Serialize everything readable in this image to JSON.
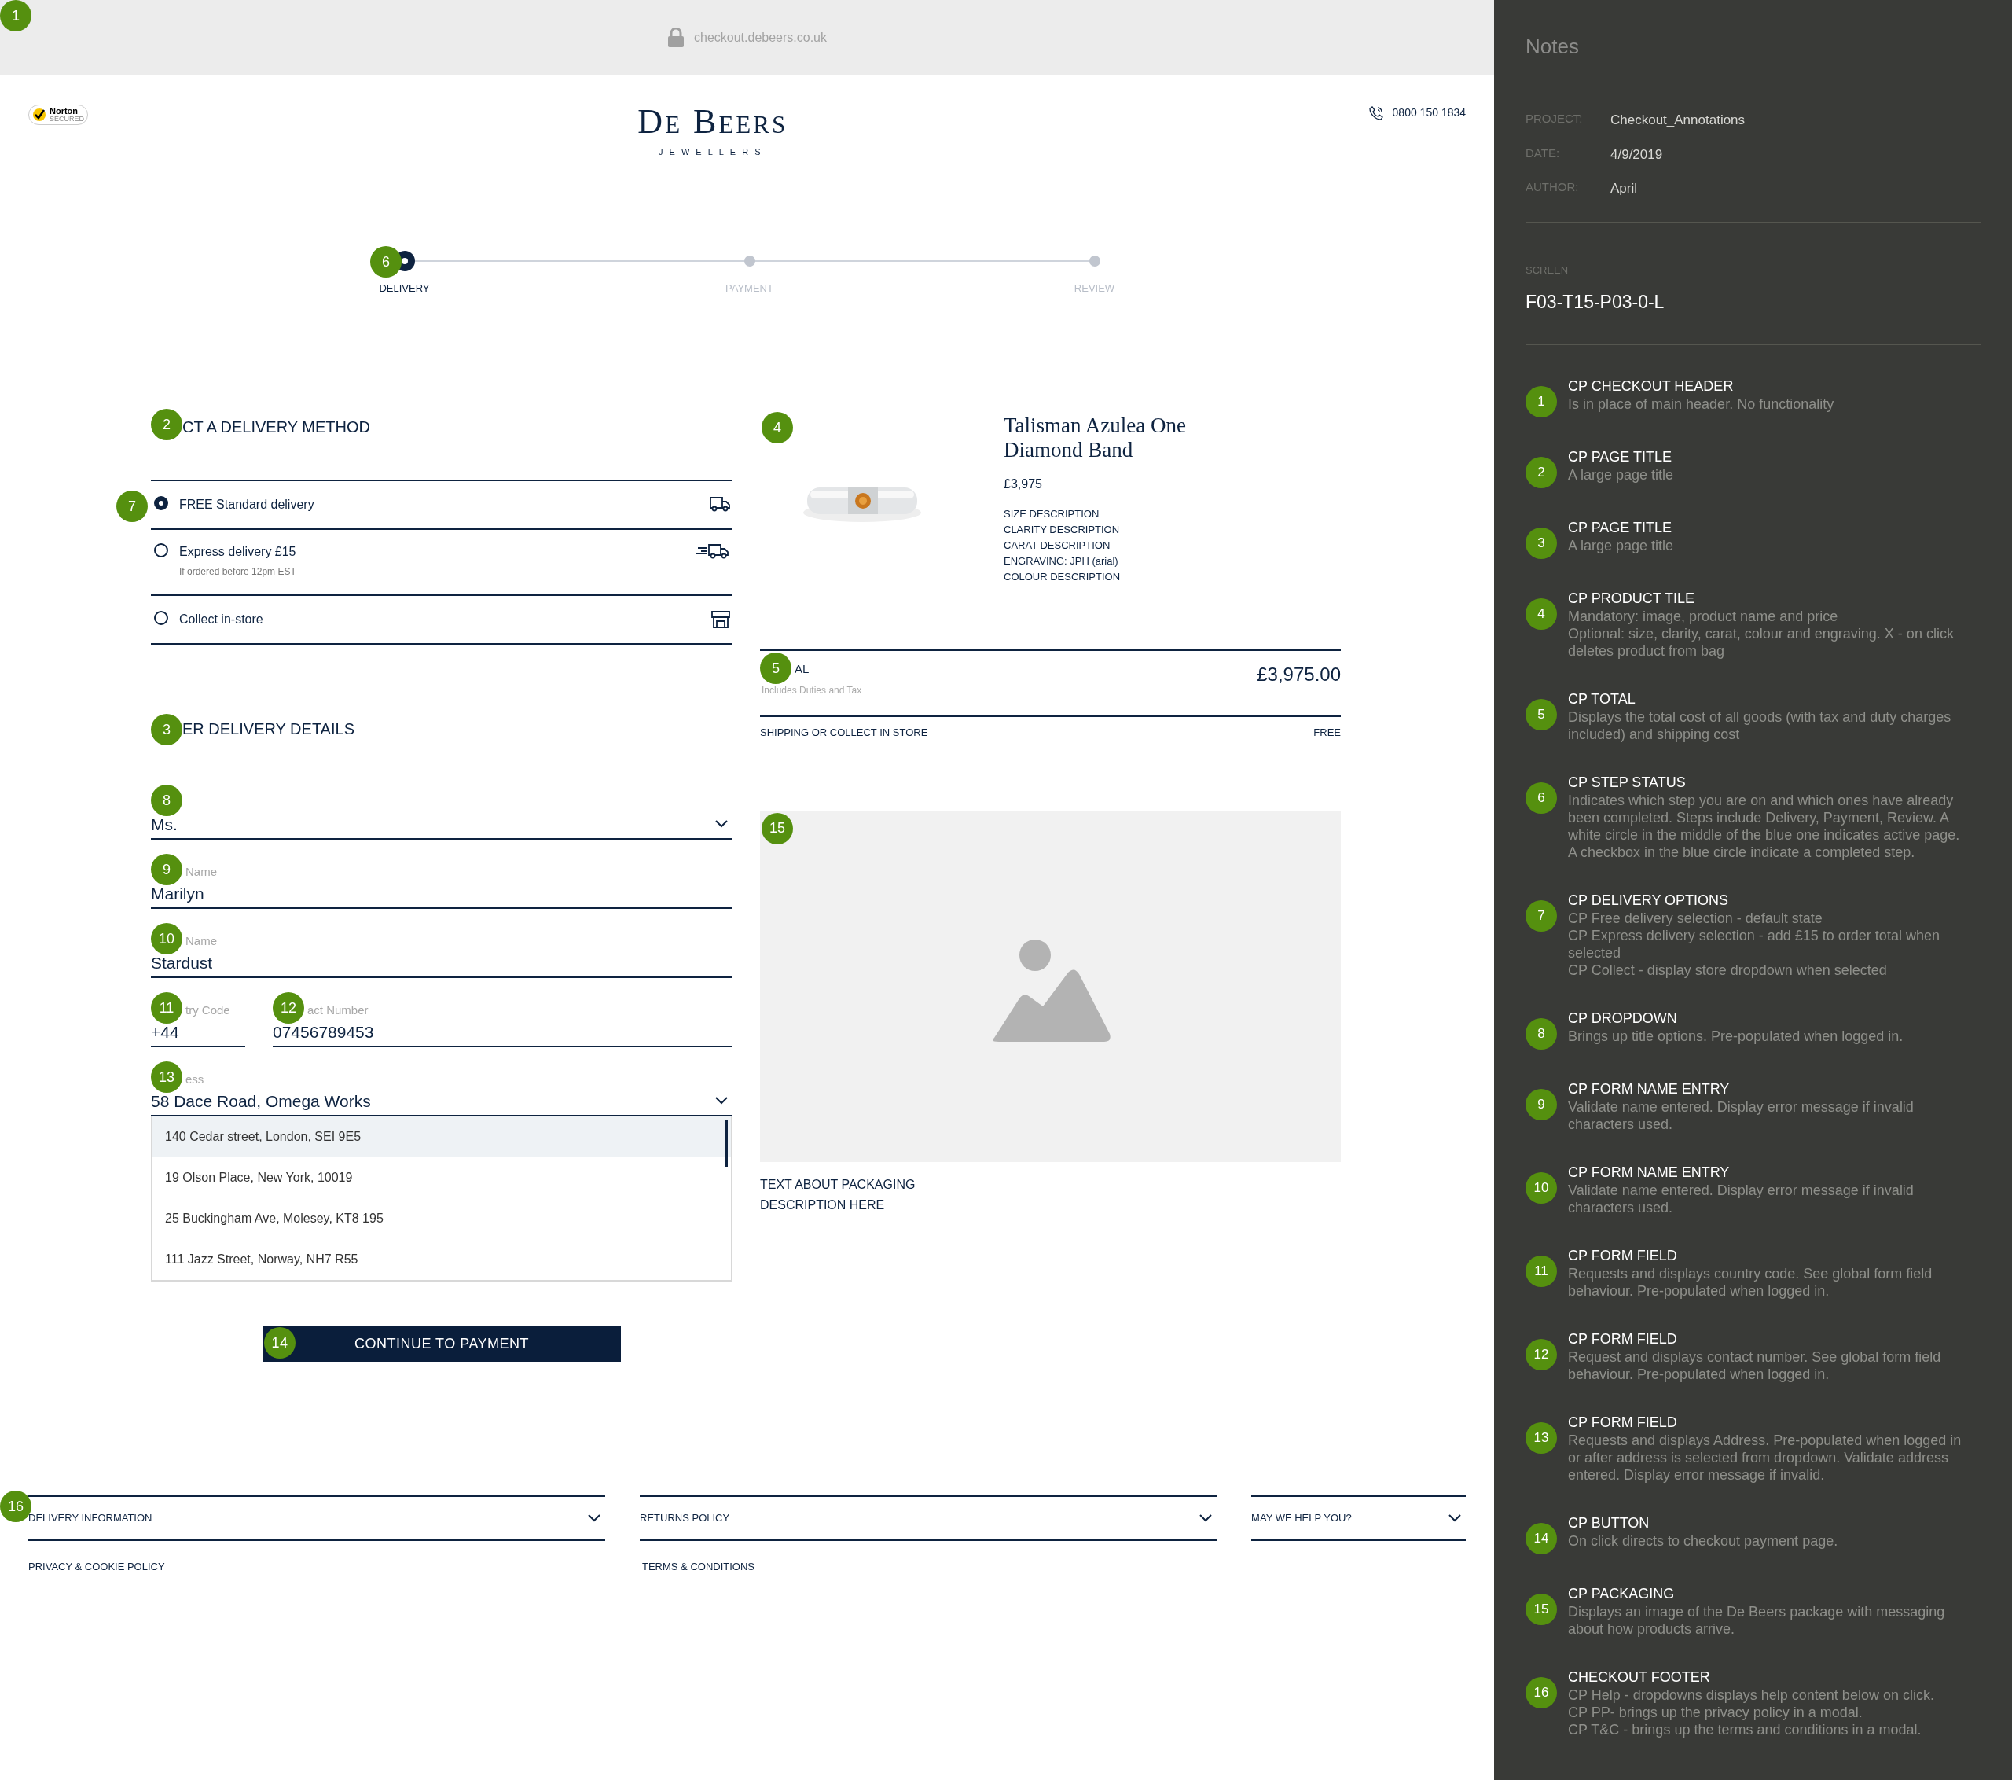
{
  "browser_bar": {
    "marker": "1",
    "url": "checkout.debeers.co.uk"
  },
  "header": {
    "seal": [
      "Norton",
      "SECURED"
    ],
    "brand": "De Beers",
    "brand_sub": "JEWELLERS",
    "phone": "0800 150 1834"
  },
  "steps": {
    "marker": "6",
    "items": [
      {
        "label": "DELIVERY",
        "selected": true
      },
      {
        "label": "PAYMENT",
        "selected": false
      },
      {
        "label": "REVIEW",
        "selected": false
      }
    ]
  },
  "delivery": {
    "marker": "2",
    "heading": "CT A DELIVERY METHOD",
    "options_marker": "7",
    "options": [
      {
        "label": "FREE Standard delivery",
        "selected": true,
        "kind": "truck"
      },
      {
        "label": "Express delivery £15",
        "note": "If ordered before 12pm EST",
        "selected": false,
        "kind": "fast-truck"
      },
      {
        "label": "Collect in-store",
        "selected": false,
        "kind": "store"
      }
    ]
  },
  "details": {
    "marker": "3",
    "heading": "ER DELIVERY DETAILS",
    "fields": [
      {
        "marker": "8",
        "kind": "select",
        "value": "Ms."
      },
      {
        "marker": "9",
        "kind": "text",
        "label": "Name",
        "value": "Marilyn"
      },
      {
        "marker": "10",
        "kind": "text",
        "label": "Name",
        "value": "Stardust"
      },
      {
        "marker": "11",
        "kind": "text",
        "label": "try Code",
        "value": "+44"
      },
      {
        "marker": "12",
        "kind": "text",
        "label": "act Number",
        "value": "07456789453"
      },
      {
        "marker": "13",
        "kind": "select",
        "label": "ess",
        "value": "58 Dace Road, Omega Works"
      }
    ],
    "suggestions": [
      {
        "text": "140 Cedar street, London, SEI 9E5",
        "selected": true
      },
      {
        "text": "19 Olson Place, New York, 10019",
        "selected": false
      },
      {
        "text": "25 Buckingham Ave, Molesey, KT8 195",
        "selected": false
      },
      {
        "text": "111 Jazz Street, Norway, NH7 R55",
        "selected": false
      }
    ],
    "button": {
      "marker": "14",
      "label": "CONTINUE TO PAYMENT"
    }
  },
  "product": {
    "marker": "4",
    "name": "Talisman Azulea One Diamond Band",
    "price": "£3,975",
    "attributes": [
      "SIZE DESCRIPTION",
      "CLARITY DESCRIPTION",
      "CARAT DESCRIPTION",
      "ENGRAVING: JPH (arial)",
      "COLOUR DESCRIPTION"
    ]
  },
  "total": {
    "marker": "5",
    "label": "AL",
    "note": "Includes Duties and Tax",
    "amount": "£3,975.00"
  },
  "shipping": {
    "label": "SHIPPING OR COLLECT IN STORE",
    "value": "FREE"
  },
  "packaging": {
    "marker": "15",
    "text": "TEXT ABOUT PACKAGING DESCRIPTION HERE"
  },
  "footer": {
    "marker": "16",
    "accordions": [
      {
        "label": "DELIVERY INFORMATION",
        "expanded": false
      },
      {
        "label": "RETURNS POLICY",
        "expanded": false
      },
      {
        "label": "MAY WE HELP YOU?",
        "expanded": false
      }
    ],
    "links": [
      "PRIVACY & COOKIE POLICY",
      "TERMS & CONDITIONS"
    ]
  },
  "notes": {
    "title": "Notes",
    "meta": [
      {
        "key": "PROJECT:",
        "value": "Checkout_Annotations"
      },
      {
        "key": "DATE:",
        "value": "4/9/2019"
      },
      {
        "key": "AUTHOR:",
        "value": "April"
      }
    ],
    "screen_label": "SCREEN",
    "screen": "F03-T15-P03-0-L",
    "items": [
      {
        "number": "1",
        "title": "CP CHECKOUT HEADER",
        "lines": [
          "Is in place of main header. No functionality"
        ]
      },
      {
        "number": "2",
        "title": "CP PAGE TITLE",
        "lines": [
          "A large page title"
        ]
      },
      {
        "number": "3",
        "title": "CP PAGE TITLE",
        "lines": [
          "A large page title"
        ]
      },
      {
        "number": "4",
        "title": "CP PRODUCT TILE",
        "lines": [
          "Mandatory: image, product name and price",
          "Optional: size, clarity, carat, colour and engraving. X - on click deletes product from bag"
        ]
      },
      {
        "number": "5",
        "title": "CP TOTAL",
        "lines": [
          "Displays the total cost of all goods (with tax and duty charges included) and shipping cost"
        ]
      },
      {
        "number": "6",
        "title": "CP STEP STATUS",
        "lines": [
          "Indicates which step you are on and which ones have already been completed. Steps include Delivery, Payment, Review. A white circle in the middle of the blue one indicates active page. A checkbox in the blue circle indicate a completed step."
        ]
      },
      {
        "number": "7",
        "title": "CP DELIVERY OPTIONS",
        "lines": [
          "CP Free delivery selection - default state",
          "CP Express delivery selection - add £15 to order total when selected",
          "CP Collect - display store dropdown when selected"
        ]
      },
      {
        "number": "8",
        "title": "CP DROPDOWN",
        "lines": [
          "Brings up title options. Pre-populated when logged in."
        ]
      },
      {
        "number": "9",
        "title": "CP FORM NAME ENTRY",
        "lines": [
          "Validate name entered. Display error message if invalid characters used."
        ]
      },
      {
        "number": "10",
        "title": "CP FORM NAME ENTRY",
        "lines": [
          "Validate name entered. Display error message if invalid characters used."
        ]
      },
      {
        "number": "11",
        "title": "CP FORM FIELD",
        "lines": [
          "Requests and displays country code. See global form field behaviour. Pre-populated when logged in."
        ]
      },
      {
        "number": "12",
        "title": "CP FORM FIELD",
        "lines": [
          "Request and displays contact number. See global form field behaviour. Pre-populated when logged in."
        ]
      },
      {
        "number": "13",
        "title": "CP FORM FIELD",
        "lines": [
          "Requests and displays Address. Pre-populated when logged in or after address is selected from dropdown. Validate address entered. Display error message if invalid."
        ]
      },
      {
        "number": "14",
        "title": "CP BUTTON",
        "lines": [
          "On click directs to checkout payment page."
        ]
      },
      {
        "number": "15",
        "title": "CP PACKAGING",
        "lines": [
          "Displays an image of the De Beers package with messaging about how products arrive."
        ]
      },
      {
        "number": "16",
        "title": "CHECKOUT FOOTER",
        "lines": [
          "CP Help - dropdowns displays help content below on click.",
          "CP PP- brings up the privacy policy in a modal.",
          "CP T&C - brings up the terms and conditions in a modal."
        ]
      }
    ]
  }
}
